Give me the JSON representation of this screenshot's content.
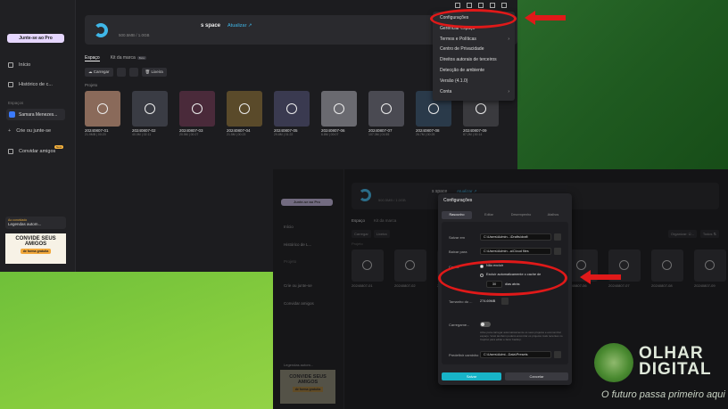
{
  "app1": {
    "pro_label": "Junte-se ao Pro",
    "nav": [
      "Início",
      "Histórico de c...",
      "Convidar amigos"
    ],
    "new_badge": "New",
    "spaces_header": "Espaços",
    "user_space": "Samara Menezes...",
    "create_label": "Crie ou junte-se",
    "promo_small_title": "Ao convidado",
    "promo_small_text": "Legendas autom...",
    "promo_title": "CONVIDE SEUS AMIGOS",
    "promo_btn": "de forma gratuita",
    "banner_title": "s space",
    "banner_upgrade": "Atualizar ↗",
    "banner_storage": "500.5MB / 1.0GB",
    "tabs": [
      "Espaço",
      "Kit da marca"
    ],
    "beta": "Beta",
    "toolbar": {
      "upload": "Carregar",
      "trash": "Lixeira"
    },
    "projects_label": "Projeto",
    "projects": [
      {
        "name": "20240807-01",
        "meta": "21.9MB | 00:20"
      },
      {
        "name": "20240807-02",
        "meta": "40.0M | 02:11"
      },
      {
        "name": "20240807-03",
        "meta": "20.5M | 00:27"
      },
      {
        "name": "20240807-04",
        "meta": "21.5M | 00:23"
      },
      {
        "name": "20240807-05",
        "meta": "29.8M | 01:22"
      },
      {
        "name": "20240807-06",
        "meta": "6.8M | 00:07"
      },
      {
        "name": "20240807-07",
        "meta": "107.3M | 01:55"
      },
      {
        "name": "20240807-08",
        "meta": "26.7M | 00:25"
      },
      {
        "name": "20240807-09",
        "meta": "87.2M | 00:14"
      }
    ],
    "menu": [
      {
        "label": "Configurações",
        "sub": false
      },
      {
        "label": "Gerenciar espaço",
        "sub": false
      },
      {
        "label": "Termos e Políticas",
        "sub": true
      },
      {
        "label": "Centro de Privacidade",
        "sub": false
      },
      {
        "label": "Direitos autorais de terceiros",
        "sub": false
      },
      {
        "label": "Detecção de ambiente",
        "sub": false
      },
      {
        "label": "Versão (4.1.0)",
        "sub": false
      },
      {
        "label": "Conta",
        "sub": true
      }
    ]
  },
  "app2": {
    "pro_label": "Junte-se ao Pro",
    "nav": [
      "Início",
      "Histórico de L...",
      "Projeto",
      "Crie ou junte-se",
      "Convidar amigos"
    ],
    "banner_title": "s space",
    "banner_upgrade": "Atualizar ↗",
    "banner_storage": "500.5MB / 1.0GB",
    "tabs": [
      "Espaço",
      "Kit da marca"
    ],
    "toolbar": {
      "upload": "Carregar",
      "trash": "Lixeira"
    },
    "right_toolbar": [
      "Organizar: Ú...",
      "Todos ⇅"
    ],
    "projects_label": "Projeto",
    "project_names": [
      "20240807-01",
      "20240807-02",
      "20240807-03",
      "20240807-04",
      "20240807-05",
      "20240807-06",
      "20240807-07",
      "20240807-08",
      "20240807-09"
    ],
    "promo_small": "Legendas autom...",
    "promo_title": "CONVIDE SEUS AMIGOS",
    "promo_btn": "de forma gratuita"
  },
  "dialog": {
    "title": "Configurações",
    "tabs": [
      "Rascunho",
      "Editar",
      "Desempenho",
      "Atalhos"
    ],
    "save_in_label": "Salvar em",
    "save_in_path": "C:\\Users\\Admin...\\Drafts\\draft",
    "cache_path_label": "Baixar para",
    "cache_path": "C:\\Users\\Admin...a\\Cloud files",
    "cache_label": "Cache",
    "cache_opt1": "Não excluir",
    "cache_opt2": "Excluir automaticamente o cache de",
    "days_value": "30",
    "days_suffix": "dias atrás",
    "cache_size_label": "Tamanho do ...",
    "cache_size": "274.69MB",
    "autoload_label": "Carregame...",
    "autoload_desc": "Ative para carregar automaticamente os seus projetos e economizar espaço. Você também poderá encontrar os projetos mais recentes no CapCut para editar e fazer backup.",
    "preset_label": "Predefinir caminho",
    "preset_path": "C:\\Users\\Admi...Data\\Presets",
    "save_btn": "Salvar",
    "cancel_btn": "Cancelar"
  },
  "watermark": {
    "line1": "OLHAR",
    "line2": "DIGITAL",
    "tagline": "O futuro passa primeiro aqui"
  },
  "colors": {
    "accent": "#3fb7e8",
    "annotation": "#e01919",
    "save": "#18b4c8"
  }
}
